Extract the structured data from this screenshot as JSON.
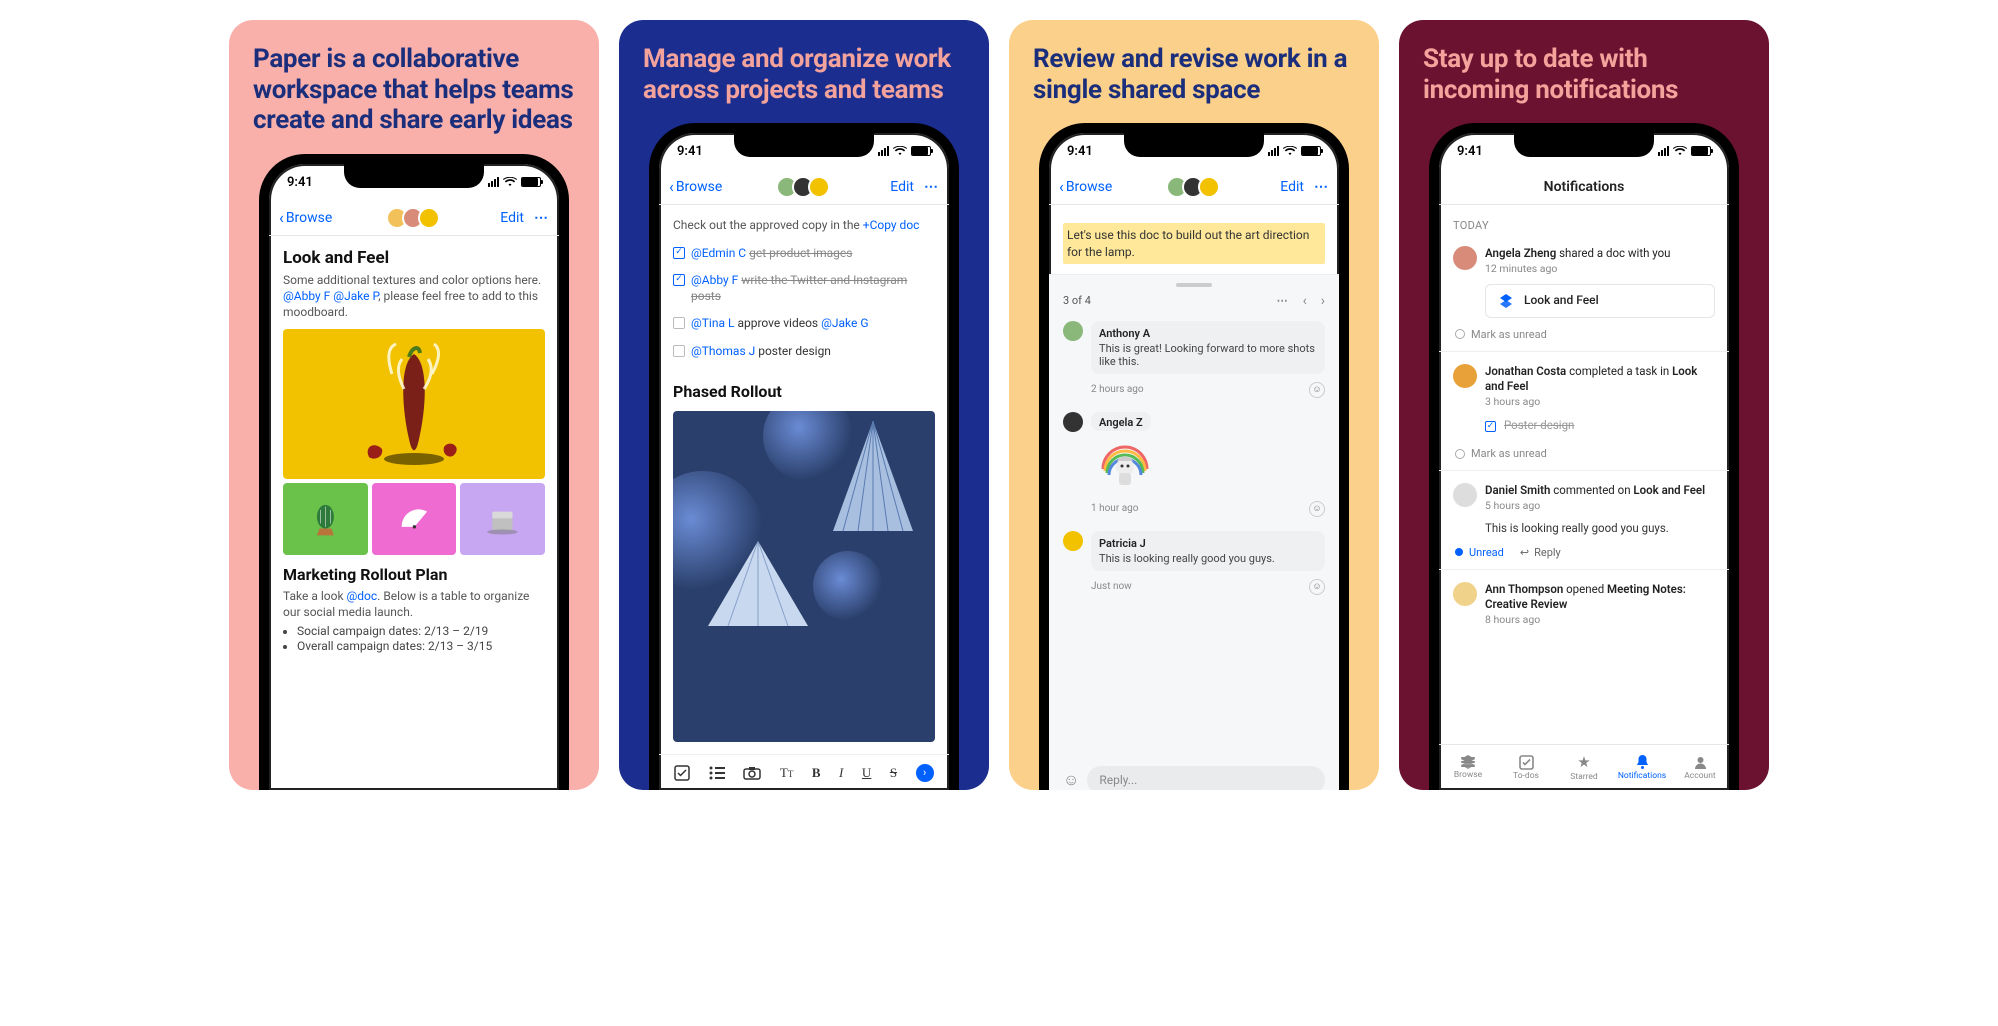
{
  "status_time": "9:41",
  "promos": [
    {
      "headline": "Paper is a collaborative workspace that helps teams create and share early ideas"
    },
    {
      "headline": "Manage and organize work across projects and teams"
    },
    {
      "headline": "Review and revise work in a single shared space"
    },
    {
      "headline": "Stay up to date with incoming notifications"
    }
  ],
  "nav": {
    "back": "Browse",
    "edit": "Edit"
  },
  "screen1": {
    "title": "Look and Feel",
    "intro_a": "Some additional textures and color options here. ",
    "mention1": "@Abby F",
    "mention2": "@Jake P",
    "intro_b": ", please feel free to add to this moodboard.",
    "h2": "Marketing Rollout Plan",
    "plan_a": "Take a look ",
    "plan_link": "@doc",
    "plan_b": ". Below is a table to organize our social media launch.",
    "bullet1": "Social campaign dates: 2/13 – 2/19",
    "bullet2": "Overall campaign dates: 2/13 – 3/15"
  },
  "screen2": {
    "intro_a": "Check out the approved copy in the ",
    "intro_link": "+Copy doc",
    "t1_m": "@Edmin C",
    "t1_t": "get product images",
    "t2_m": "@Abby F",
    "t2_t": "write the Twitter and Instagram posts",
    "t3_m": "@Tina L",
    "t3_t": "approve videos",
    "t3_m2": "@Jake G",
    "t4_m": "@Thomas J",
    "t4_t": "poster design",
    "h2": "Phased Rollout"
  },
  "screen3": {
    "highlight": "Let's use this doc to build out the art direction for the lamp.",
    "counter": "3 of 4",
    "c1_who": "Anthony A",
    "c1_msg": "This is great! Looking forward to more shots like this.",
    "c1_time": "2 hours ago",
    "c2_who": "Angela Z",
    "c2_time": "1 hour ago",
    "c3_who": "Patricia J",
    "c3_msg": "This is looking really good you guys.",
    "c3_time": "Just now",
    "reply_placeholder": "Reply..."
  },
  "screen4": {
    "title": "Notifications",
    "section": "TODAY",
    "n1_who": "Angela Zheng",
    "n1_act": "shared a doc with you",
    "n1_time": "12 minutes ago",
    "chip_label": "Look and Feel",
    "mark_unread": "Mark as unread",
    "n2_who": "Jonathan Costa",
    "n2_act": "completed a task in",
    "n2_obj": "Look and Feel",
    "n2_time": "3 hours ago",
    "n2_task": "Poster design",
    "n3_who": "Daniel Smith",
    "n3_act": "commented on",
    "n3_obj": "Look and Feel",
    "n3_time": "5 hours ago",
    "n3_quote": "This is looking really good you guys.",
    "unread": "Unread",
    "reply": "Reply",
    "n4_who": "Ann Thompson",
    "n4_act": "opened",
    "n4_obj": "Meeting Notes: Creative Review",
    "n4_time": "8 hours ago",
    "tabs": {
      "browse": "Browse",
      "todos": "To-dos",
      "starred": "Starred",
      "notifications": "Notifications",
      "account": "Account"
    }
  }
}
